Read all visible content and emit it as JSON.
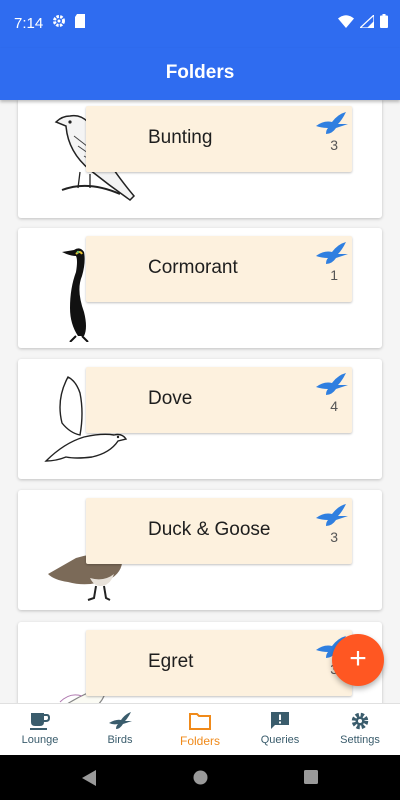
{
  "status_bar": {
    "time": "7:14"
  },
  "app_bar": {
    "title": "Folders"
  },
  "folders": [
    {
      "name": "Bunting",
      "count": "3"
    },
    {
      "name": "Cormorant",
      "count": "1"
    },
    {
      "name": "Dove",
      "count": "4"
    },
    {
      "name": "Duck & Goose",
      "count": "3"
    },
    {
      "name": "Egret",
      "count": "3"
    }
  ],
  "fab": {
    "label": "+"
  },
  "bottom_nav": {
    "items": [
      {
        "label": "Lounge",
        "icon": "coffee-cup-icon"
      },
      {
        "label": "Birds",
        "icon": "bird-icon"
      },
      {
        "label": "Folders",
        "icon": "folder-icon"
      },
      {
        "label": "Queries",
        "icon": "feedback-icon"
      },
      {
        "label": "Settings",
        "icon": "gear-icon"
      }
    ],
    "active": "Folders"
  },
  "colors": {
    "primary": "#2f6cf0",
    "accent": "#ff5722",
    "active_tab": "#f08a1a",
    "card_label_bg": "#fdf1de"
  }
}
